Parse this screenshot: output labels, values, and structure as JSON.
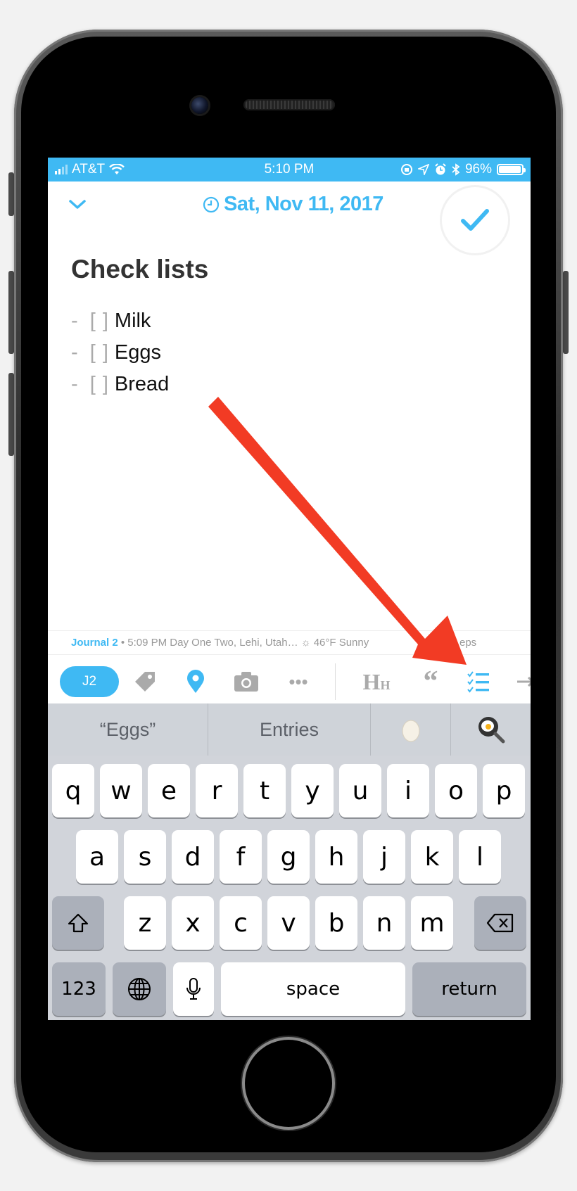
{
  "status_bar": {
    "carrier": "AT&T",
    "time": "5:10 PM",
    "battery": "96%",
    "battery_level": 0.96
  },
  "entry": {
    "date": "Sat, Nov 11, 2017",
    "title": "Check lists",
    "items": [
      {
        "prefix": "-",
        "box": "[ ]",
        "text": "Milk"
      },
      {
        "prefix": "-",
        "box": "[ ]",
        "text": "Eggs"
      },
      {
        "prefix": "-",
        "box": "[ ]",
        "text": "Bread"
      }
    ]
  },
  "meta": {
    "journal": "Journal 2",
    "details": " • 5:09 PM Day One Two, Lehi, Utah… ☼ 46°F Sunny",
    "trailing": "eps"
  },
  "toolbar": {
    "journal_badge": "J2",
    "more": "•••",
    "heading": "H",
    "heading_sub": "H",
    "quote": "“"
  },
  "suggestions": [
    "“Eggs”",
    "Entries",
    "🥚",
    "🍳"
  ],
  "keyboard": {
    "row1": [
      "q",
      "w",
      "e",
      "r",
      "t",
      "y",
      "u",
      "i",
      "o",
      "p"
    ],
    "row2": [
      "a",
      "s",
      "d",
      "f",
      "g",
      "h",
      "j",
      "k",
      "l"
    ],
    "row3": [
      "z",
      "x",
      "c",
      "v",
      "b",
      "n",
      "m"
    ],
    "numbers": "123",
    "space": "space",
    "return": "return"
  },
  "colors": {
    "accent": "#3fb9f3",
    "annotation_arrow": "#f23b24"
  }
}
